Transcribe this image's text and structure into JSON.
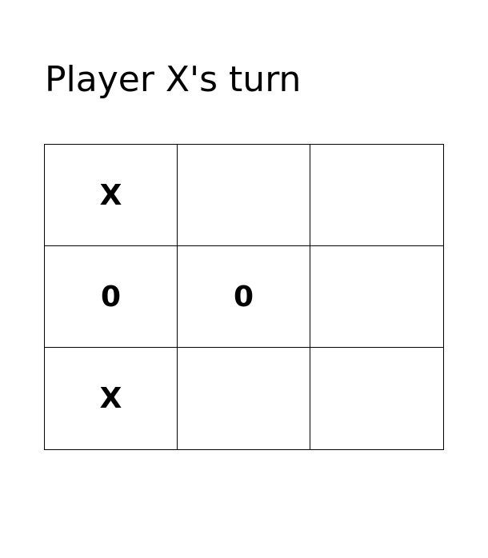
{
  "status": {
    "text": "Player X's turn"
  },
  "board": {
    "cells": [
      [
        "X",
        "",
        ""
      ],
      [
        "0",
        "0",
        ""
      ],
      [
        "X",
        "",
        ""
      ]
    ]
  }
}
